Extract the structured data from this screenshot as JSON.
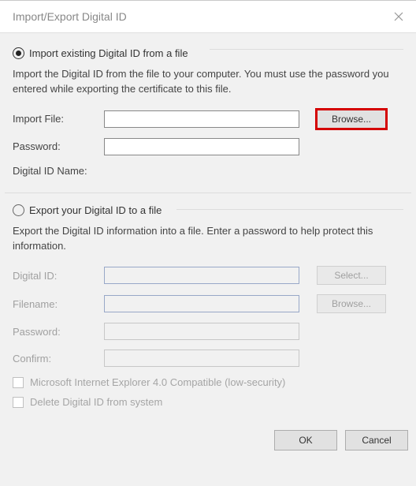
{
  "dialog": {
    "title": "Import/Export Digital ID"
  },
  "import": {
    "radio_label": "Import existing Digital ID from a file",
    "desc": "Import the Digital ID from the file to your computer. You must use the password you entered while exporting the certificate to this file.",
    "import_file_label": "Import File:",
    "import_file_value": "",
    "browse_label": "Browse...",
    "password_label": "Password:",
    "password_value": "",
    "name_label": "Digital ID Name:"
  },
  "export": {
    "radio_label": "Export your Digital ID to a file",
    "desc": "Export the Digital ID information into a file. Enter a password to help protect this information.",
    "digital_id_label": "Digital ID:",
    "digital_id_value": "",
    "select_label": "Select...",
    "filename_label": "Filename:",
    "filename_value": "",
    "browse_label": "Browse...",
    "password_label": "Password:",
    "password_value": "",
    "confirm_label": "Confirm:",
    "confirm_value": "",
    "ie4_label": "Microsoft Internet Explorer 4.0 Compatible (low-security)",
    "delete_label": "Delete Digital ID from system"
  },
  "footer": {
    "ok_label": "OK",
    "cancel_label": "Cancel"
  },
  "radio_selected": "import"
}
